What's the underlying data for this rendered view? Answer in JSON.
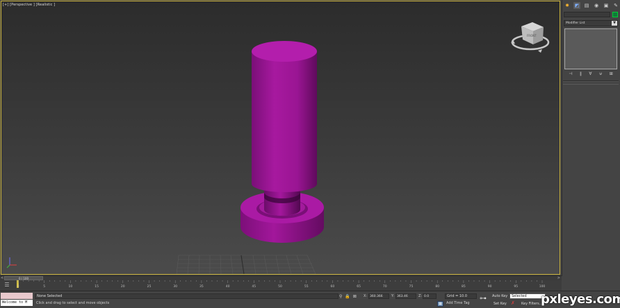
{
  "viewport": {
    "label": "[+] [Perspective ] [Realistic ]",
    "object_color": "#a0169e",
    "background_top": "#2c2c2c",
    "background_bottom": "#4b4b4b"
  },
  "view_cube": {
    "face_label": "FRONT"
  },
  "command_panel": {
    "modifier_list": "Modifier List",
    "object_color": "#117a3a"
  },
  "timeline": {
    "slider_label": "0 / 100",
    "left_arrow": "<",
    "right_arrow": ">",
    "ticks": [
      "0",
      "5",
      "10",
      "15",
      "20",
      "25",
      "30",
      "35",
      "40",
      "45",
      "50",
      "55",
      "60",
      "65",
      "70",
      "75",
      "80",
      "85",
      "90",
      "95",
      "100"
    ]
  },
  "status": {
    "selection": "None Selected",
    "prompt": "Click and drag to select and move objects",
    "maxscript": "Welcome to M",
    "x_label": "X:",
    "x_value": "360.366",
    "y_label": "Y:",
    "y_value": "363.46",
    "z_label": "Z:",
    "z_value": "0.0",
    "grid": "Grid = 10.0",
    "add_time_tag": "Add Time Tag",
    "auto_key": "Auto Key",
    "selected": "Selected",
    "set_key": "Set Key",
    "key_filters": "Key Filters..."
  },
  "watermark": {
    "text": "pxleyes.com"
  }
}
